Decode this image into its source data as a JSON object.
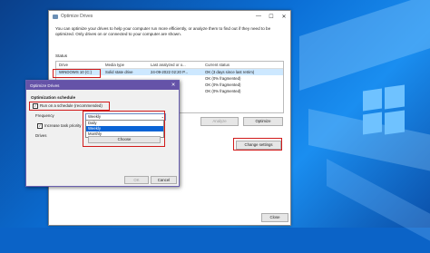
{
  "main_window": {
    "title": "Optimize Drives",
    "minimize": "—",
    "maximize": "☐",
    "close": "✕",
    "intro": "You can optimize your drives to help your computer run more efficiently, or analyze them to find out if they need to be optimized. Only drives on or connected to your computer are shown.",
    "status_label": "Status",
    "columns": [
      "Drive",
      "Media type",
      "Last analyzed or o...",
      "Current status"
    ],
    "rows": [
      {
        "drive": "WINDOWS 10 (C:)",
        "media": "Solid state drive",
        "last": "24-09-2022 02:20 P...",
        "status": "OK (3 days since last retrim)"
      },
      {
        "drive": "",
        "media": "",
        "last": "",
        "status": "OK (0% fragmented)"
      },
      {
        "drive": "",
        "media": "",
        "last": "",
        "status": "OK (0% fragmented)"
      },
      {
        "drive": "",
        "media": "",
        "last": "",
        "status": "OK (0% fragmented)"
      }
    ],
    "analyze_label": "Analyze",
    "optimize_label": "Optimize",
    "change_settings_label": "Change settings",
    "close_label": "Close"
  },
  "dialog": {
    "title": "Optimize Drives",
    "close": "✕",
    "heading": "Optimization schedule",
    "run_schedule_label": "Run on a schedule (recommended)",
    "frequency_label": "Frequency",
    "frequency_value": "Weekly",
    "frequency_options": [
      "Daily",
      "Weekly",
      "Monthly"
    ],
    "increase_priority_label": "Increase task priority",
    "drives_label": "Drives",
    "choose_label": "Choose",
    "ok_label": "OK",
    "cancel_label": "Cancel"
  },
  "colors": {
    "highlight": "#d11a1a",
    "dialog_title": "#6553a8",
    "selection": "#0a64d6"
  }
}
